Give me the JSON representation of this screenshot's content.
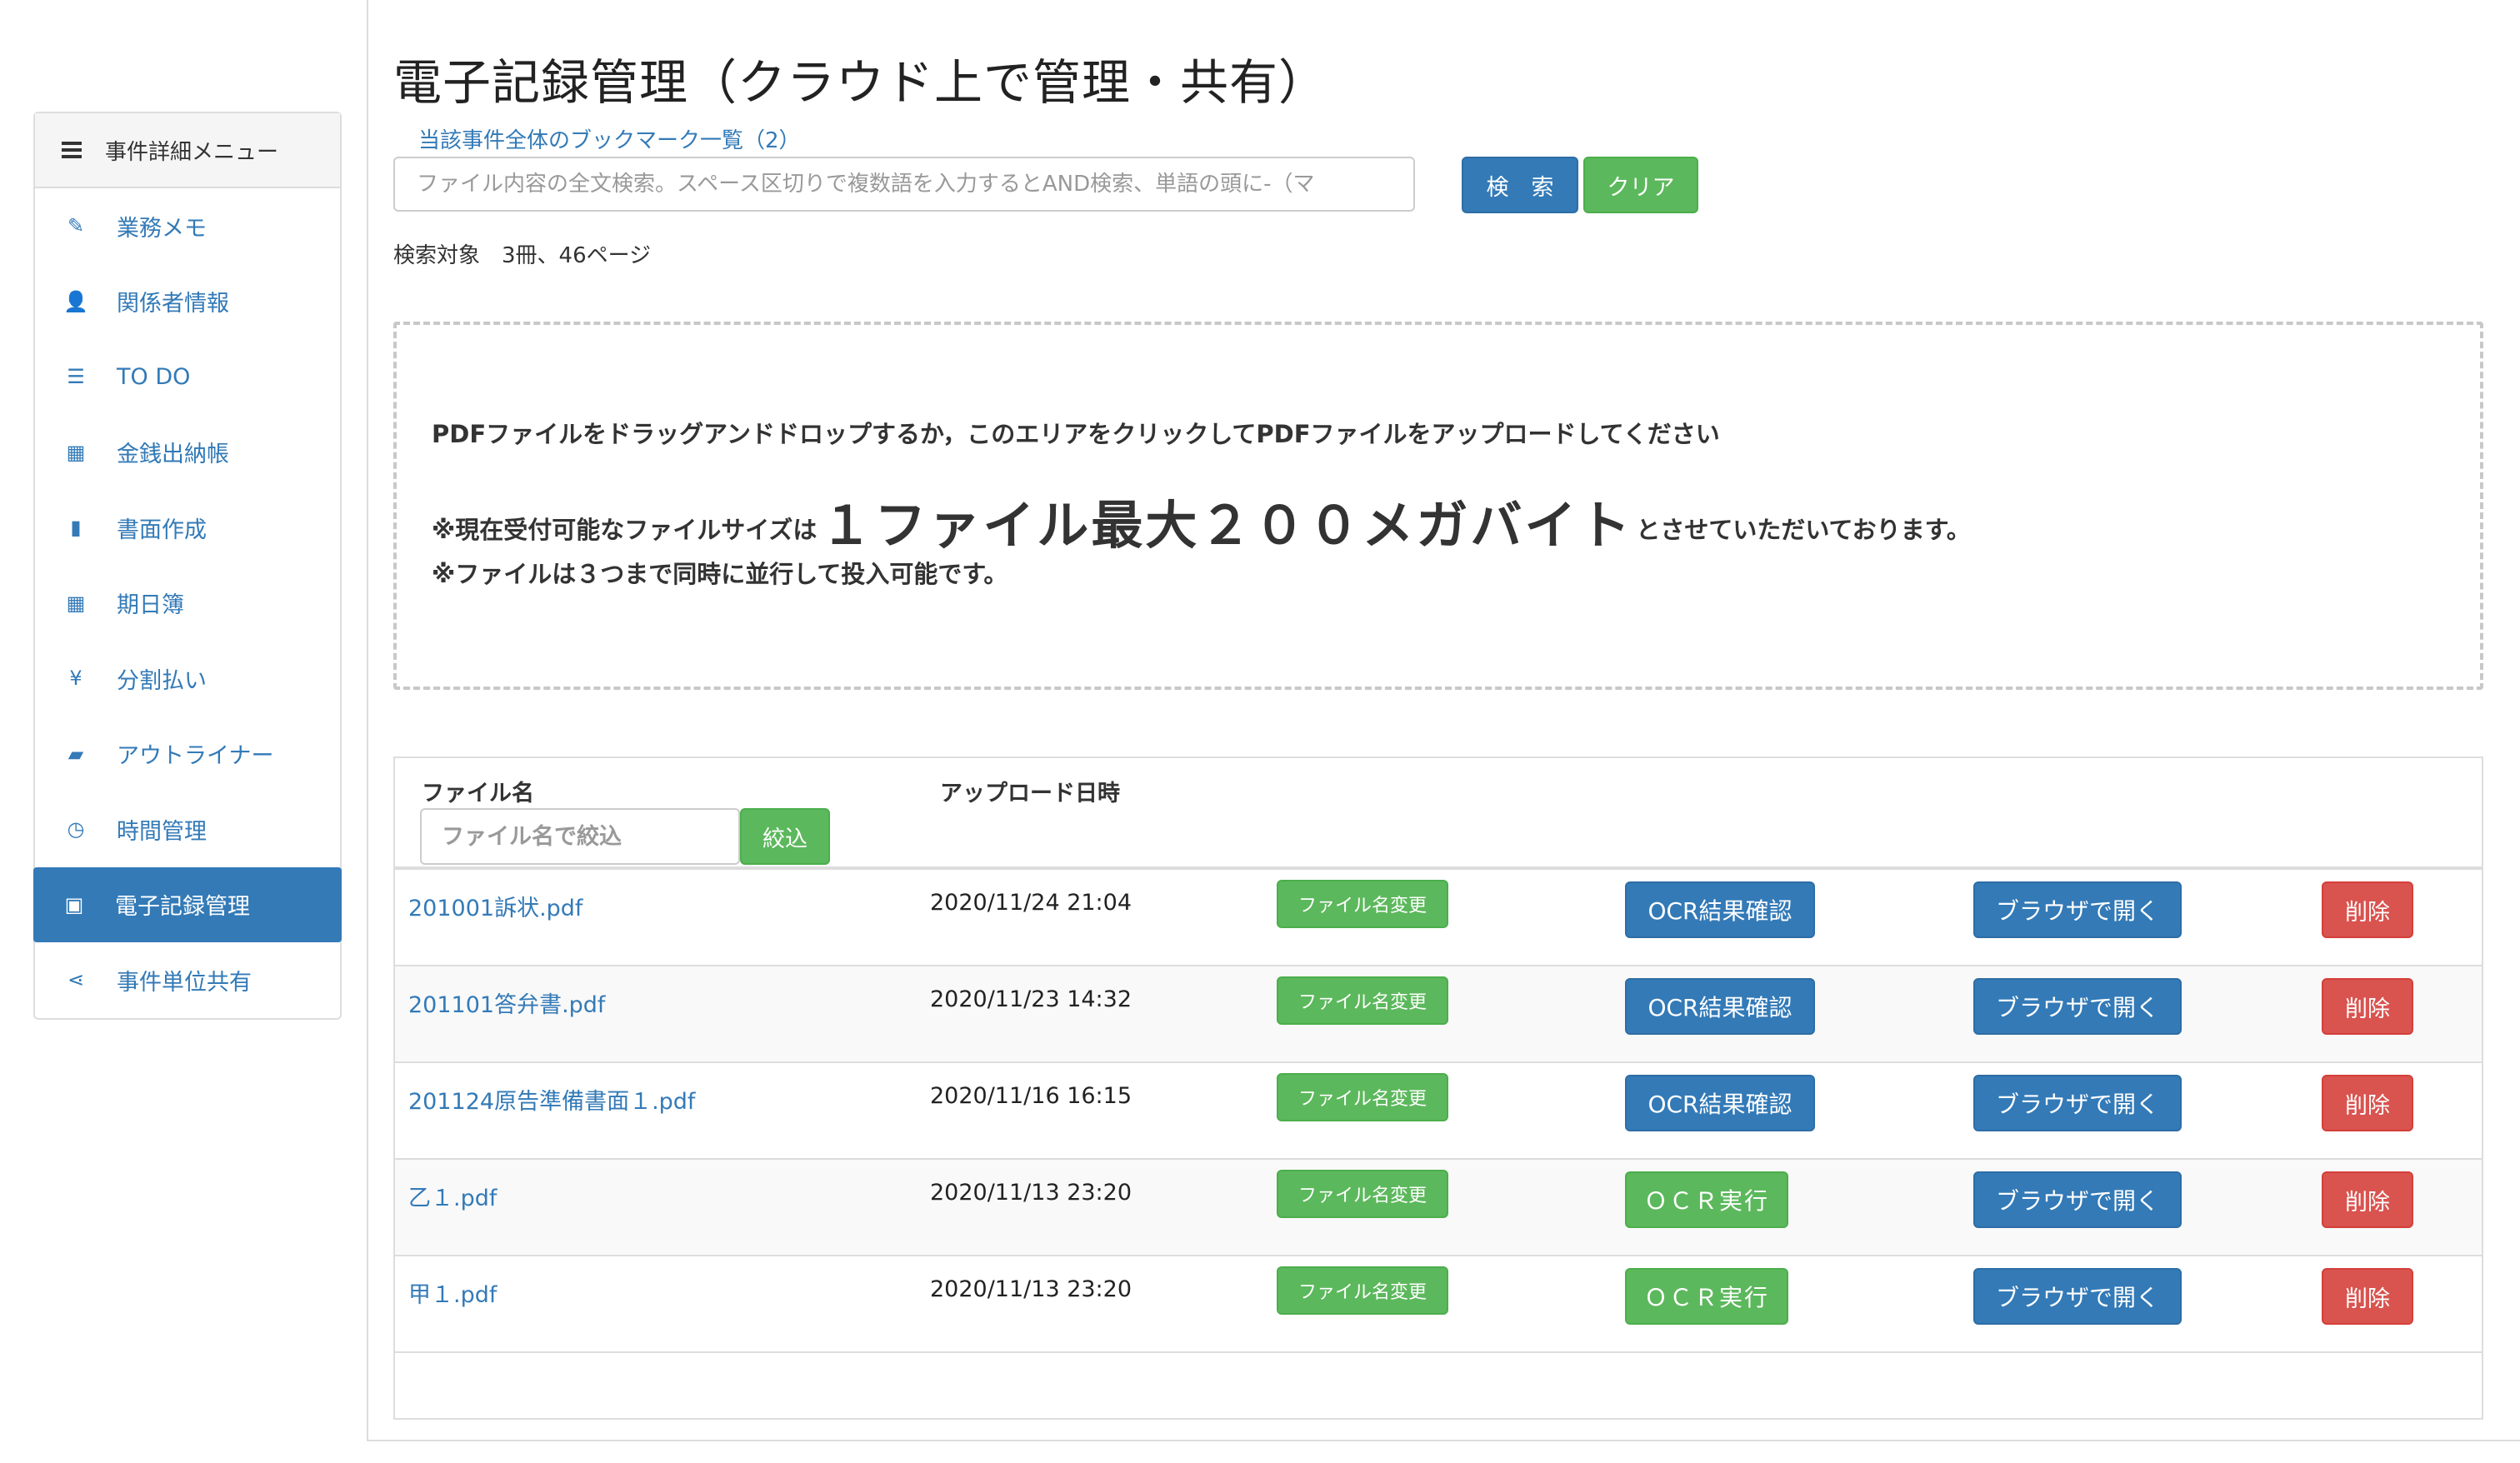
{
  "sidebar": {
    "header": "事件詳細メニュー",
    "items": [
      {
        "label": "業務メモ",
        "icon": "pencil-icon",
        "glyph": "✎"
      },
      {
        "label": "関係者情報",
        "icon": "user-icon",
        "glyph": "👤"
      },
      {
        "label": "TO DO",
        "icon": "list-icon",
        "glyph": "☰"
      },
      {
        "label": "金銭出納帳",
        "icon": "calculator-icon",
        "glyph": "▦"
      },
      {
        "label": "書面作成",
        "icon": "file-icon",
        "glyph": "▮"
      },
      {
        "label": "期日簿",
        "icon": "calendar-icon",
        "glyph": "▦"
      },
      {
        "label": "分割払い",
        "icon": "yen-icon",
        "glyph": "¥"
      },
      {
        "label": "アウトライナー",
        "icon": "book-icon",
        "glyph": "▰"
      },
      {
        "label": "時間管理",
        "icon": "clock-icon",
        "glyph": "◷"
      },
      {
        "label": "電子記録管理",
        "icon": "word-file-icon",
        "glyph": "▣"
      },
      {
        "label": "事件単位共有",
        "icon": "share-icon",
        "glyph": "⋖"
      }
    ],
    "active_index": 9
  },
  "page": {
    "title": "電子記録管理（クラウド上で管理・共有）",
    "bookmark_link": "当該事件全体のブックマーク一覧（2）"
  },
  "search": {
    "placeholder": "ファイル内容の全文検索。スペース区切りで複数語を入力するとAND検索、単語の頭に-（マ",
    "search_label": "検　索",
    "clear_label": "クリア",
    "target_text": "検索対象　3冊、46ページ"
  },
  "dropzone": {
    "line1": "PDFファイルをドラッグアンドドロップするか，このエリアをクリックしてPDFファイルをアップロードしてください",
    "line2_prefix": "※現在受付可能なファイルサイズは",
    "line2_big": "１ファイル最大２００メガバイト",
    "line2_suffix": "とさせていただいております。",
    "line3": "※ファイルは３つまで同時に並行して投入可能です。"
  },
  "table": {
    "col_filename": "ファイル名",
    "col_uploaded": "アップロード日時",
    "filter_placeholder": "ファイル名で絞込",
    "filter_button": "絞込",
    "rename_label": "ファイル名変更",
    "ocr_check_label": "OCR結果確認",
    "ocr_run_label": "ＯＣＲ実行",
    "open_label": "ブラウザで開く",
    "delete_label": "削除",
    "rows": [
      {
        "name": "201001訴状.pdf",
        "date": "2020/11/24 21:04",
        "ocr_done": true
      },
      {
        "name": "201101答弁書.pdf",
        "date": "2020/11/23 14:32",
        "ocr_done": true
      },
      {
        "name": "201124原告準備書面１.pdf",
        "date": "2020/11/16 16:15",
        "ocr_done": true
      },
      {
        "name": "乙１.pdf",
        "date": "2020/11/13 23:20",
        "ocr_done": false
      },
      {
        "name": "甲１.pdf",
        "date": "2020/11/13 23:20",
        "ocr_done": false
      }
    ]
  },
  "colors": {
    "primary": "#337ab7",
    "success": "#5cb85c",
    "danger": "#d9534f"
  }
}
